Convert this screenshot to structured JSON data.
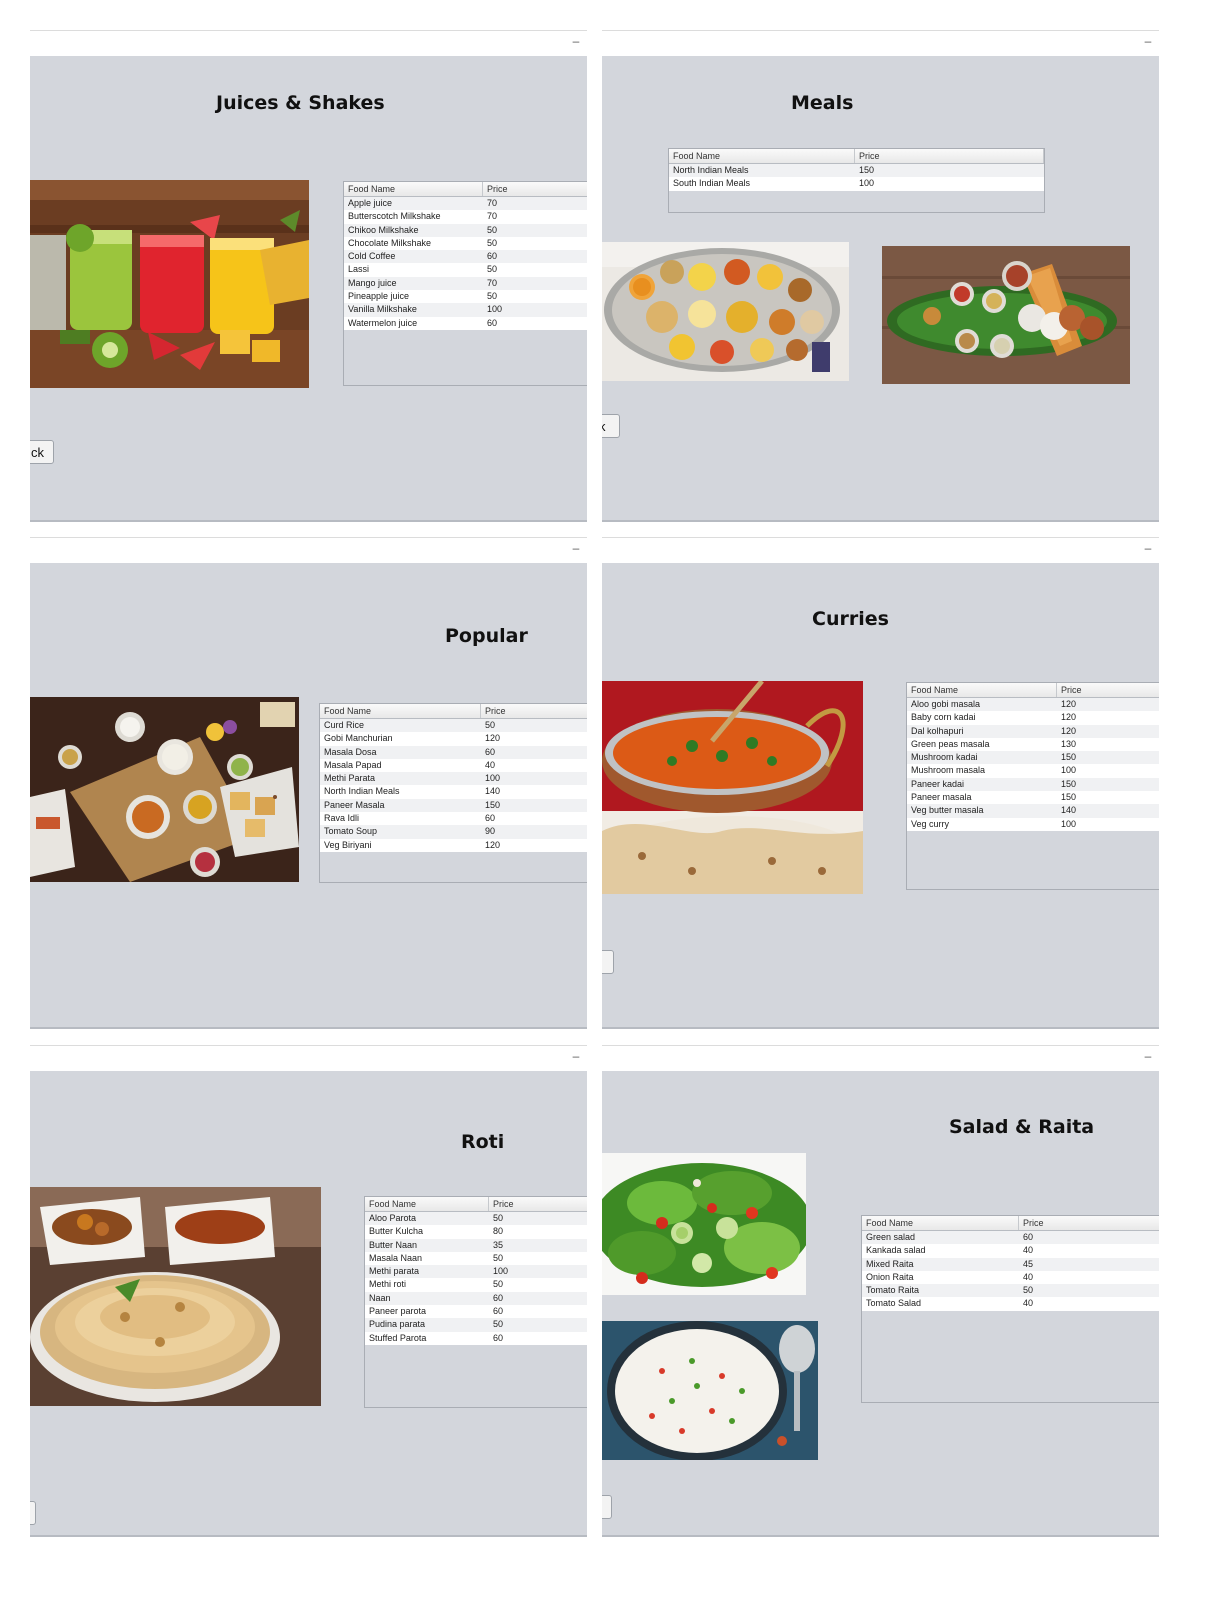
{
  "col_name_header": "Food Name",
  "col_price_header": "Price",
  "windows": [
    {
      "title": "Juices & Shakes",
      "back_label": "ck",
      "items": [
        [
          "Apple juice",
          "70"
        ],
        [
          "Butterscotch Milkshake",
          "70"
        ],
        [
          "Chikoo Milkshake",
          "50"
        ],
        [
          "Chocolate Milkshake",
          "50"
        ],
        [
          "Cold Coffee",
          "60"
        ],
        [
          "Lassi",
          "50"
        ],
        [
          "Mango juice",
          "70"
        ],
        [
          "Pineapple juice",
          "50"
        ],
        [
          "Vanilla Milkshake",
          "100"
        ],
        [
          "Watermelon juice",
          "60"
        ]
      ]
    },
    {
      "title": "Meals",
      "back_label": "k",
      "items": [
        [
          "North Indian Meals",
          "150"
        ],
        [
          "South Indian Meals",
          "100"
        ]
      ]
    },
    {
      "title": "Popular",
      "back_label": "",
      "items": [
        [
          "Curd Rice",
          "50"
        ],
        [
          "Gobi Manchurian",
          "120"
        ],
        [
          "Masala Dosa",
          "60"
        ],
        [
          "Masala Papad",
          "40"
        ],
        [
          "Methi Parata",
          "100"
        ],
        [
          "North Indian Meals",
          "140"
        ],
        [
          "Paneer Masala",
          "150"
        ],
        [
          "Rava Idli",
          "60"
        ],
        [
          "Tomato Soup",
          "90"
        ],
        [
          "Veg Biriyani",
          "120"
        ]
      ]
    },
    {
      "title": "Curries",
      "back_label": ":",
      "items": [
        [
          "Aloo gobi masala",
          "120"
        ],
        [
          "Baby corn kadai",
          "120"
        ],
        [
          "Dal kolhapuri",
          "120"
        ],
        [
          "Green peas masala",
          "130"
        ],
        [
          "Mushroom kadai",
          "150"
        ],
        [
          "Mushroom masala",
          "100"
        ],
        [
          "Paneer kadai",
          "150"
        ],
        [
          "Paneer masala",
          "150"
        ],
        [
          "Veg butter masala",
          "140"
        ],
        [
          "Veg curry",
          "100"
        ]
      ]
    },
    {
      "title": "Roti",
      "back_label": "",
      "items": [
        [
          "Aloo Parota",
          "50"
        ],
        [
          "Butter Kulcha",
          "80"
        ],
        [
          "Butter Naan",
          "35"
        ],
        [
          "Masala Naan",
          "50"
        ],
        [
          "Methi parata",
          "100"
        ],
        [
          "Methi roti",
          "50"
        ],
        [
          "Naan",
          "60"
        ],
        [
          "Paneer parota",
          "60"
        ],
        [
          "Pudina parata",
          "50"
        ],
        [
          "Stuffed Parota",
          "60"
        ]
      ]
    },
    {
      "title": "Salad & Raita",
      "back_label": "",
      "items": [
        [
          "Green salad",
          "60"
        ],
        [
          "Kankada salad",
          "40"
        ],
        [
          "Mixed Raita",
          "45"
        ],
        [
          "Onion Raita",
          "40"
        ],
        [
          "Tomato Raita",
          "50"
        ],
        [
          "Tomato Salad",
          "40"
        ]
      ]
    }
  ],
  "minimize_glyph": "–"
}
